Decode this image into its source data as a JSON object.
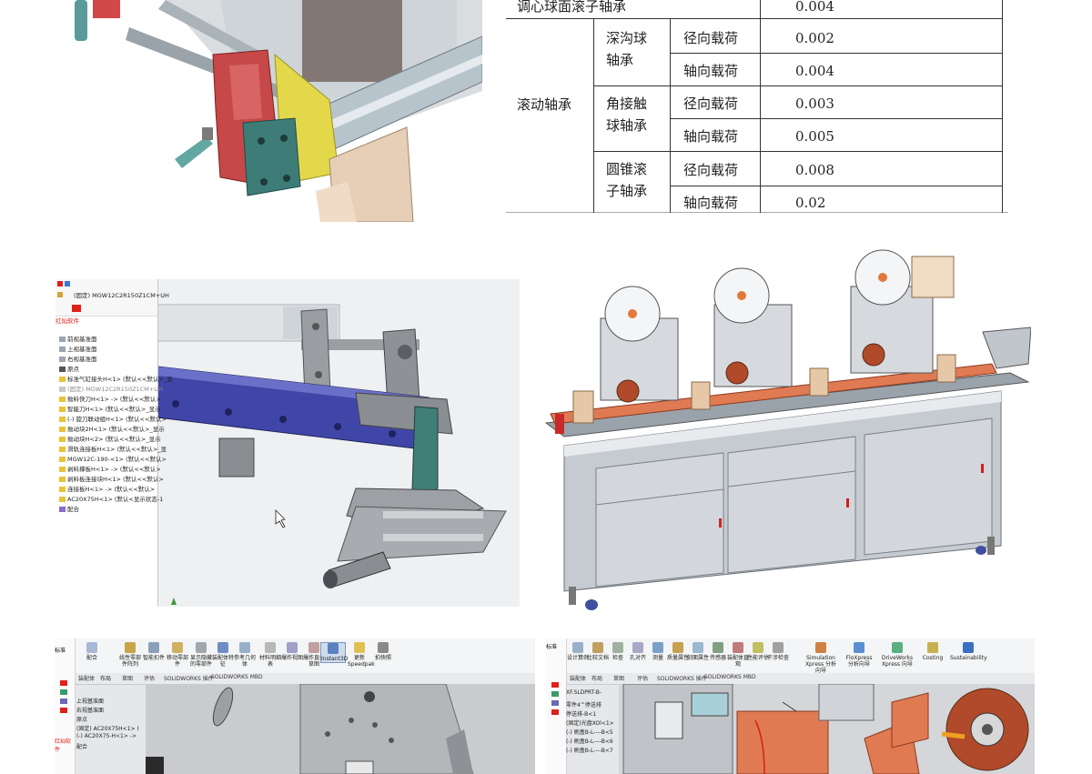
{
  "table": {
    "top_row": {
      "label": "调心球面滚子轴承",
      "value": "0.004"
    },
    "group_label": "滚动轴承",
    "subgroups": [
      {
        "name": "深沟球轴承",
        "rows": [
          {
            "load": "径向载荷",
            "value": "0.002"
          },
          {
            "load": "轴向载荷",
            "value": "0.004"
          }
        ]
      },
      {
        "name": "角接触球轴承",
        "rows": [
          {
            "load": "径向载荷",
            "value": "0.003"
          },
          {
            "load": "轴向载荷",
            "value": "0.005"
          }
        ]
      },
      {
        "name": "圆锥滚子轴承",
        "rows": [
          {
            "load": "径向载荷",
            "value": "0.008"
          },
          {
            "load": "轴向载荷",
            "value": "0.02"
          }
        ]
      }
    ]
  },
  "cad_tree": {
    "brand_label": "红灿软件",
    "rows": [
      "(固定) MGW12C2R150Z1CM+UH",
      "前视基准面",
      "上视基准面",
      "右视基准面",
      "原点",
      "标准气缸接头H<1> (默认<<默认>_显",
      "(固定) MGW12C2R150Z1CM+UH",
      "抛料快刀H<1> -> (默认<<默认>",
      "智能刀H<1> (默认<<默认>_显示",
      "(-) 旋刀联动组H<1> (默认<<默认>",
      "抛动块2H<1> (默认<<默认>_显示",
      "抛动块H<2> (默认<<默认>_显示",
      "滑轨连接板H<1> (默认<<默认>_显",
      "MGW12C-190-<1> (默认<<默认>",
      "剥料撑板H<1> -> (默认<<默认>",
      "剥料板连接块H<1> (默认<<默认>",
      "连接板H<1> -> (默认<<默认>",
      "AC20X75H<1> (默认<显示状态-1",
      "配合"
    ]
  },
  "ribbon_left": {
    "buttons": [
      "配合",
      "线性零部件阵列",
      "智能扣件",
      "移动零部件",
      "显示隐藏的零部件",
      "装配体特征",
      "参考几何体",
      "材料明细表",
      "爆炸视图",
      "爆炸直线草图",
      "Instant3D",
      "更新Speedpak",
      "拍快照"
    ],
    "tabs": [
      "装配体",
      "布局",
      "草图",
      "评估",
      "SOLIDWORKS 插件",
      "SOLIDWORKS MBD"
    ],
    "tree": [
      "上视基准面",
      "右视基准面",
      "原点",
      "(固定) AC20X75H<1> (",
      "(-) AC20X75-H<1> ->",
      "配合"
    ],
    "brand_label": "红灿软件"
  },
  "ribbon_right": {
    "buttons": [
      "设计算例",
      "比较文档",
      "检查",
      "孔对齐",
      "测量",
      "质量属性",
      "剖面属性",
      "传感器",
      "装配体直观",
      "性能评估",
      "干涉检查",
      "Simulation Xpress 分析向导",
      "FloXpress 分析向导",
      "DriveWorks Xpress 向导",
      "Costing",
      "Sustainability"
    ],
    "tabs": [
      "装配体",
      "布局",
      "草图",
      "评估",
      "SOLIDWORKS 插件",
      "SOLIDWORKS MBD"
    ],
    "file_label": "XF.SLDPRT-B-",
    "tree": [
      "零件4^停送排",
      "停送排-B<1",
      "(固定)光盘XOl<1>",
      "(-) 刷盒B-L----B<5",
      "(-) 刷盒B-L----B<6",
      "(-) 刷盒B-L----B<7"
    ]
  },
  "colors": {
    "brand_red": "#e0201a",
    "rail_blue": "#4046a8",
    "machine_gray": "#c6cbd1",
    "orange_parts": "#e07a52"
  }
}
